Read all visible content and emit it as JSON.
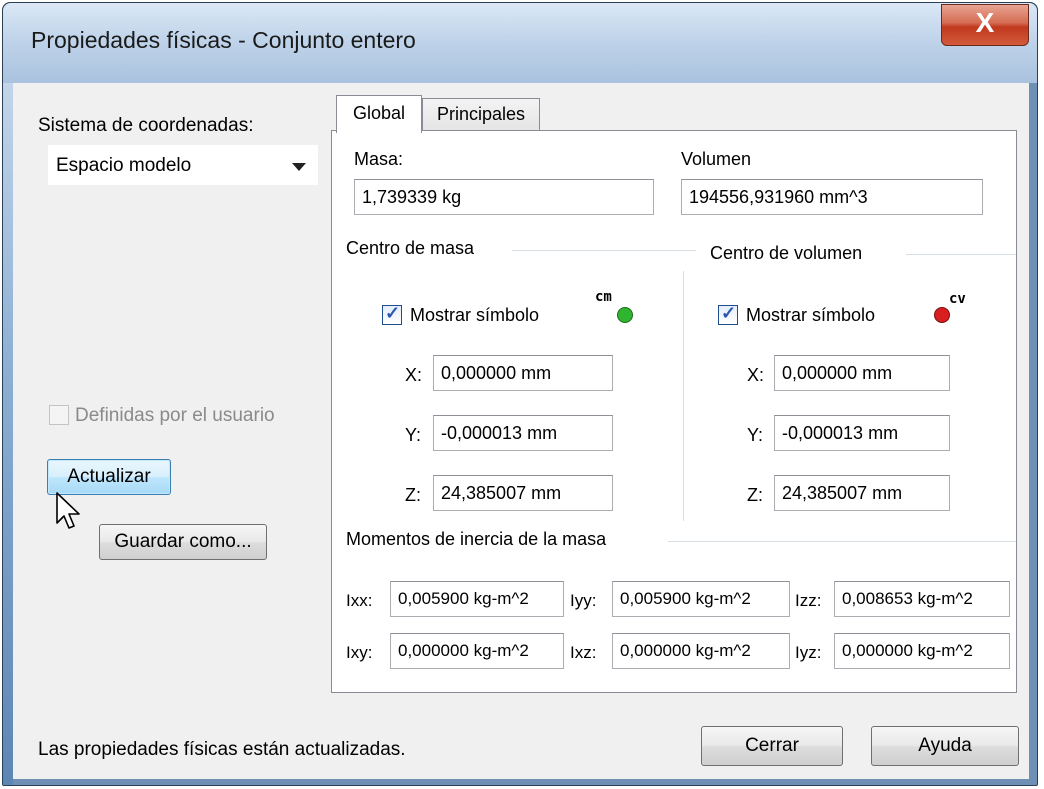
{
  "window": {
    "title": "Propiedades físicas - Conjunto entero",
    "close_glyph": "X"
  },
  "left": {
    "coord_label": "Sistema de coordenadas:",
    "coord_value": "Espacio modelo",
    "user_defined_label": "Definidas por el usuario",
    "user_defined_checked": false,
    "update_button": "Actualizar",
    "save_button": "Guardar como..."
  },
  "tabs": [
    {
      "label": "Global",
      "active": true
    },
    {
      "label": "Principales",
      "active": false
    }
  ],
  "global": {
    "mass_label": "Masa:",
    "mass_value": "1,739339 kg",
    "volume_label": "Volumen",
    "volume_value": "194556,931960 mm^3",
    "center_mass": {
      "heading": "Centro de masa",
      "show_symbol_label": "Mostrar símbolo",
      "show_symbol_checked": true,
      "symbol_text": "cm",
      "symbol_color": "#2fb52f",
      "x_label": "X:",
      "x_value": "0,000000 mm",
      "y_label": "Y:",
      "y_value": "-0,000013 mm",
      "z_label": "Z:",
      "z_value": "24,385007 mm"
    },
    "center_volume": {
      "heading": "Centro de volumen",
      "show_symbol_label": "Mostrar símbolo",
      "show_symbol_checked": true,
      "symbol_text": "cv",
      "symbol_color": "#d81e1e",
      "x_label": "X:",
      "x_value": "0,000000 mm",
      "y_label": "Y:",
      "y_value": "-0,000013 mm",
      "z_label": "Z:",
      "z_value": "24,385007 mm"
    },
    "inertia": {
      "heading": "Momentos de inercia de la masa",
      "ixx_label": "Ixx:",
      "ixx_value": "0,005900 kg-m^2",
      "iyy_label": "Iyy:",
      "iyy_value": "0,005900 kg-m^2",
      "izz_label": "Izz:",
      "izz_value": "0,008653 kg-m^2",
      "ixy_label": "Ixy:",
      "ixy_value": "0,000000 kg-m^2",
      "ixz_label": "Ixz:",
      "ixz_value": "0,000000 kg-m^2",
      "iyz_label": "Iyz:",
      "iyz_value": "0,000000 kg-m^2"
    }
  },
  "footer": {
    "status": "Las propiedades físicas están actualizadas.",
    "close_button": "Cerrar",
    "help_button": "Ayuda"
  }
}
